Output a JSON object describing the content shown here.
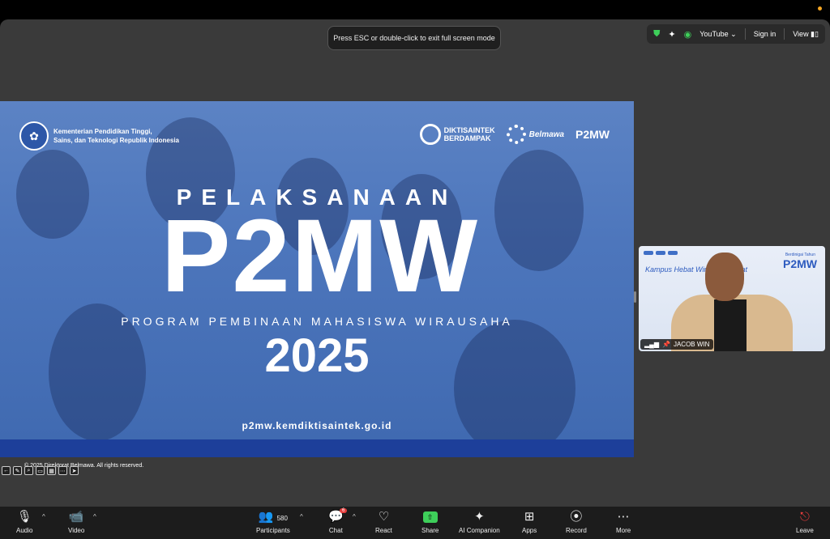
{
  "fullscreen_banner": "Press ESC or double-click to exit full screen mode",
  "top_bar": {
    "youtube_label": "YouTube",
    "sign_in": "Sign in",
    "view": "View"
  },
  "slide": {
    "ministry_line1": "Kementerian Pendidikan Tinggi,",
    "ministry_line2": "Sains, dan Teknologi Republik Indonesia",
    "partner1_line1": "DIKTISAINTEK",
    "partner1_line2": "BERDAMPAK",
    "partner2": "Belmawa",
    "partner3": "P2MW",
    "heading": "PELAKSANAAN",
    "big_title": "P2MW",
    "subtitle": "PROGRAM PEMBINAAN MAHASISWA WIRAUSAHA",
    "year": "2025",
    "url": "p2mw.kemdiktisaintek.go.id",
    "copyright": "© 2025 Direktorat Belmawa. All rights reserved."
  },
  "video": {
    "name": "JACOB WIN",
    "brand": "P2MW",
    "brand_small": "Berdinigai Tahun",
    "script_text": "Kampus Hebat Wirausaha Kuat"
  },
  "toolbar": {
    "audio": "Audio",
    "video": "Video",
    "participants": "Participants",
    "participant_count": "580",
    "chat": "Chat",
    "chat_badge": "6",
    "react": "React",
    "share": "Share",
    "ai_companion": "AI Companion",
    "apps": "Apps",
    "record": "Record",
    "more": "More",
    "leave": "Leave"
  }
}
